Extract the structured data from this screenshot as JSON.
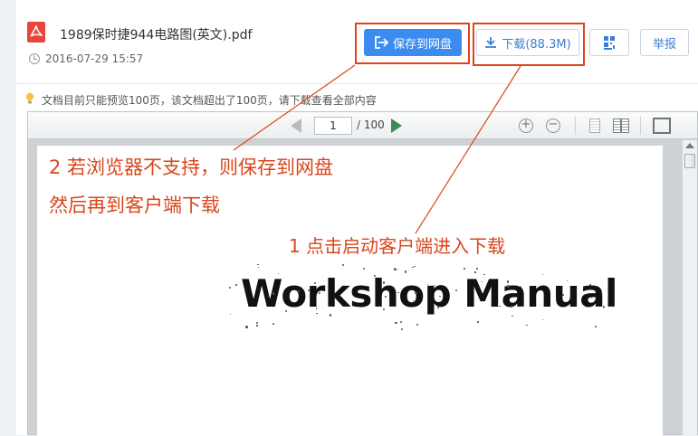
{
  "file": {
    "title": "1989保时捷944电路图(英文).pdf",
    "date": "2016-07-29 15:57",
    "icon": "pdf-icon"
  },
  "actions": {
    "save_label": "保存到网盘",
    "download_label": "下载(88.3M)",
    "report_label": "举报"
  },
  "notice": "文档目前只能预览100页，该文档超出了100页，请下载查看全部内容",
  "viewer": {
    "current_page": "1",
    "total_pages": "/ 100",
    "zoom_in": "+",
    "zoom_out": "−"
  },
  "document": {
    "heading": "Workshop Manual"
  },
  "annotations": {
    "line1": "2 若浏览器不支持，则保存到网盘",
    "line2": "然后再到客户端下载",
    "line3": "1 点击启动客户端进入下载"
  },
  "colors": {
    "accent": "#3b8cf0",
    "highlight": "#e0431c",
    "annotation": "#d9461a"
  }
}
